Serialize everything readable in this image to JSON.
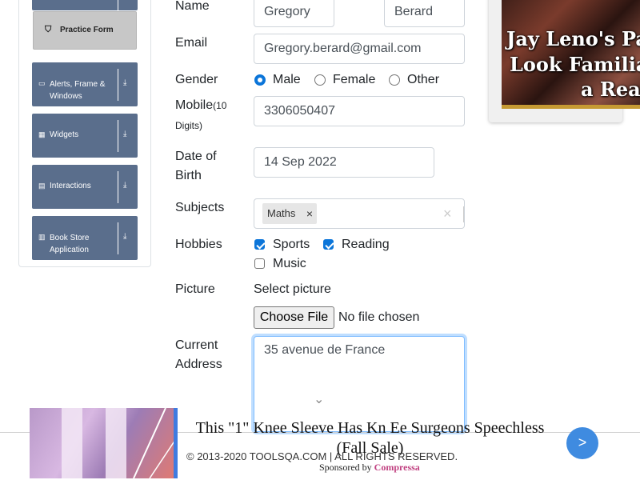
{
  "sidebar": {
    "items": [
      {
        "label": "Practice Form",
        "icon": "html5-icon"
      },
      {
        "label": "Alerts, Frame & Windows",
        "icon": "window-icon"
      },
      {
        "label": "Widgets",
        "icon": "grid-icon"
      },
      {
        "label": "Interactions",
        "icon": "box-icon"
      },
      {
        "label": "Book Store Application",
        "icon": "books-icon"
      }
    ]
  },
  "form": {
    "name_label": "Name",
    "first_name": "Gregory",
    "last_name": "Berard",
    "email_label": "Email",
    "email": "Gregory.berard@gmail.com",
    "gender_label": "Gender",
    "gender_options": [
      "Male",
      "Female",
      "Other"
    ],
    "gender_selected": "Male",
    "mobile_label": "Mobile",
    "mobile_hint": "(10",
    "mobile_hint2": "Digits)",
    "mobile": "3306050407",
    "dob_label_1": "Date of",
    "dob_label_2": "Birth",
    "dob": "14 Sep 2022",
    "subjects_label": "Subjects",
    "subject_chip": "Maths",
    "chip_remove": "×",
    "clear_all": "×",
    "hobbies_label": "Hobbies",
    "hobbies": [
      {
        "label": "Sports",
        "checked": true
      },
      {
        "label": "Reading",
        "checked": true
      },
      {
        "label": "Music",
        "checked": false
      }
    ],
    "picture_label": "Picture",
    "select_picture": "Select picture",
    "choose_file": "Choose File",
    "no_file": "No file chosen",
    "address_label_1": "Current",
    "address_label_2": "Address",
    "address": "35 avenue de France"
  },
  "ad_top": {
    "line1": "Jay Leno's Par",
    "line2": "Look Familiar",
    "line3": "a Reas"
  },
  "banner": {
    "title_line1": "This \"1\" Knee Sleeve Has Kn Ee Surgeons Speechless",
    "title_line2": "(Fall Sale)",
    "next": ">"
  },
  "footer": {
    "copyright": "© 2013-2020 TOOLSQA.COM | ALL RIGHTS RESERVED.",
    "sponsored_by": "Sponsored by",
    "sponsor": "Compressa"
  },
  "colors": {
    "sidebar_group": "#5a6e8c",
    "active_item": "#c7c7c7",
    "accent": "#0b75d9",
    "banner_accent": "#3f7be0"
  }
}
